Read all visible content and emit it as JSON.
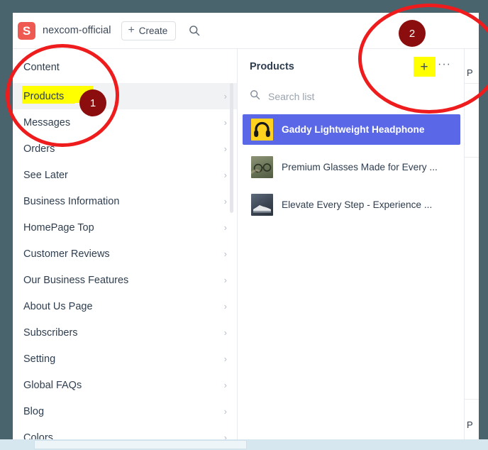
{
  "window": {
    "frame_color": "#4a646e",
    "app_background": "#ffffff"
  },
  "topbar": {
    "logo_letter": "S",
    "logo_color": "#ee5a52",
    "brand_name": "nexcom-official",
    "create_button": {
      "plus": "+",
      "label": "Create"
    },
    "search_icon_name": "search-icon"
  },
  "sidebar": {
    "heading": "Content",
    "active_item": "Products",
    "chevron": "›",
    "items": [
      {
        "label": "Products"
      },
      {
        "label": "Messages"
      },
      {
        "label": "Orders"
      },
      {
        "label": "See Later"
      },
      {
        "label": "Business Information"
      },
      {
        "label": "HomePage Top"
      },
      {
        "label": "Customer Reviews"
      },
      {
        "label": "Our Business Features"
      },
      {
        "label": "About Us Page"
      },
      {
        "label": "Subscribers"
      },
      {
        "label": "Setting"
      },
      {
        "label": "Global FAQs"
      },
      {
        "label": "Blog"
      },
      {
        "label": "Colors"
      }
    ]
  },
  "list_panel": {
    "title": "Products",
    "add_button_glyph": "+",
    "more_button_glyph": "···",
    "search": {
      "placeholder": "Search list",
      "value": ""
    },
    "items": [
      {
        "title": "Gaddy Lightweight Headphone",
        "thumb": "headphone",
        "selected": true
      },
      {
        "title": "Premium Glasses Made for Every ...",
        "thumb": "glasses",
        "selected": false
      },
      {
        "title": "Elevate Every Step - Experience ...",
        "thumb": "shoe",
        "selected": false
      }
    ],
    "selected_color": "#5a68e8"
  },
  "detail_panel": {
    "clipped_text": "P"
  },
  "annotations": {
    "highlight_color": "#ffff00",
    "circle_color": "#ee1c1c",
    "badge_color": "#8b0d0d",
    "badges": [
      {
        "number": "1",
        "target": "sidebar-item-products"
      },
      {
        "number": "2",
        "target": "list-panel-add-button"
      }
    ]
  }
}
